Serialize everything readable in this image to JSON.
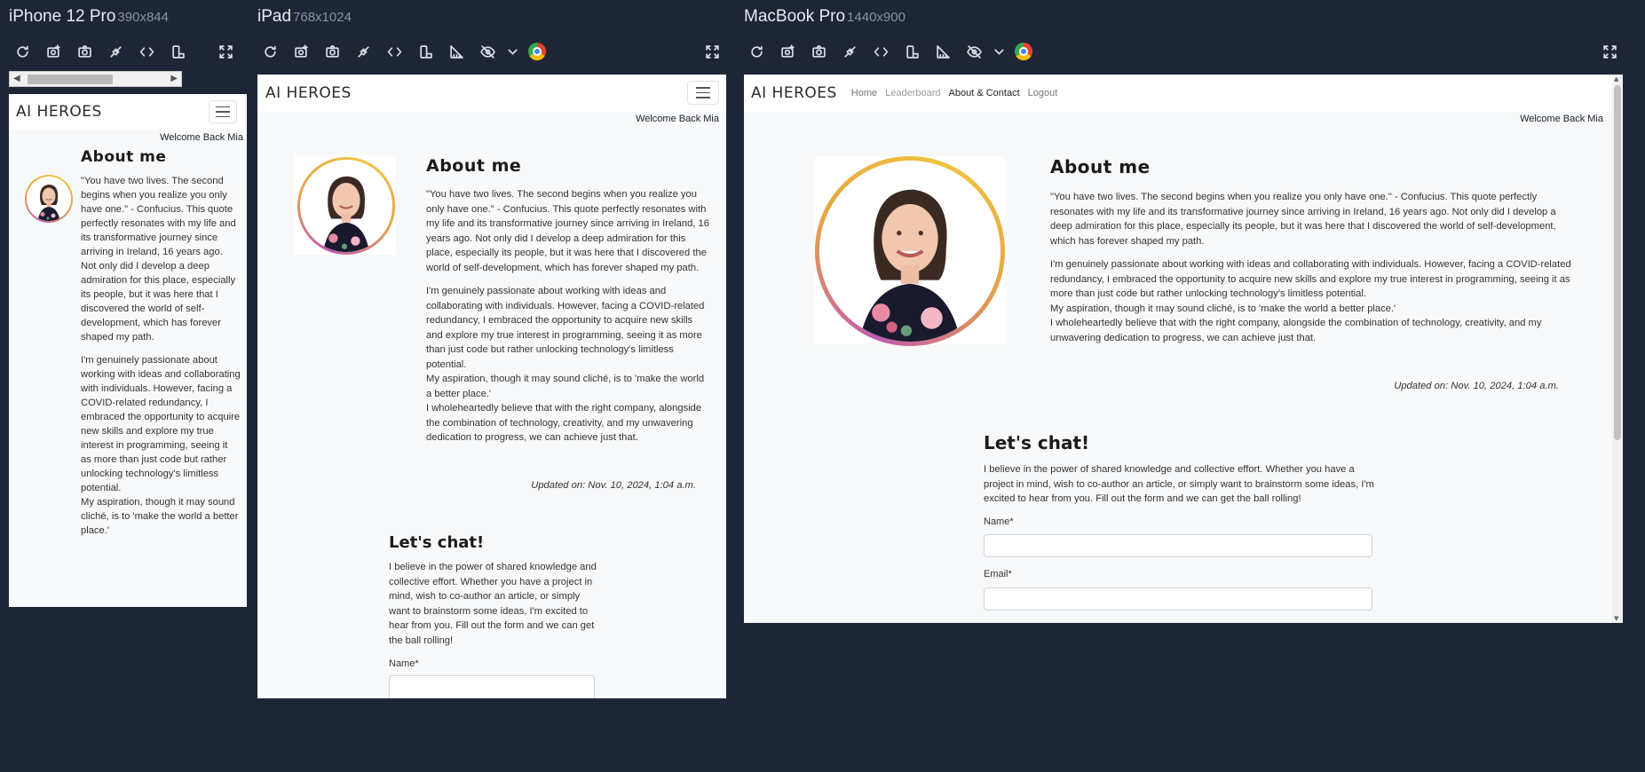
{
  "devices": [
    {
      "name": "iPhone 12 Pro",
      "dims": "390x844"
    },
    {
      "name": "iPad",
      "dims": "768x1024"
    },
    {
      "name": "MacBook Pro",
      "dims": "1440x900"
    }
  ],
  "toolbar": {
    "icons": [
      "refresh-icon",
      "screenshot-icon",
      "camera-icon",
      "sync-icon",
      "code-icon",
      "rotate-icon",
      "ruler-icon",
      "eye-off-icon",
      "chevron-down-icon",
      "chrome-icon",
      "fullscreen-icon"
    ]
  },
  "site": {
    "brand": "AI HEROES",
    "nav": [
      "Home",
      "Leaderboard",
      "About & Contact",
      "Logout"
    ],
    "welcome": "Welcome Back Mia",
    "about_title": "About me",
    "p1": "\"You have two lives. The second begins when you realize you only have one.\" - Confucius. This quote perfectly resonates with my life and its transformative journey since arriving in Ireland, 16 years ago. Not only did I develop a deep admiration for this place, especially its people, but it was here that I discovered the world of self-development, which has forever shaped my path.",
    "p2": "I'm genuinely passionate about working with ideas and collaborating with individuals. However, facing a COVID-related redundancy, I embraced the opportunity to acquire new skills and explore my true interest in programming, seeing it as more than just code but rather unlocking technology's limitless potential.",
    "p3": "My aspiration, though it may sound cliché, is to 'make the world a better place.'",
    "p4": "I wholeheartedly believe that with the right company, alongside the combination of technology, creativity, and my unwavering dedication to progress, we can achieve just that.",
    "updated": "Updated on: Nov. 10, 2024, 1:04 a.m.",
    "chat_title": "Let's chat!",
    "chat_text": "I believe in the power of shared knowledge and collective effort. Whether you have a project in mind, wish to co-author an article, or simply want to brainstorm some ideas, I'm excited to hear from you. Fill out the form and we can get the ball rolling!",
    "name_label": "Name*",
    "email_label": "Email*"
  },
  "colors": {
    "background": "#1e2636",
    "page": "#f8f9fa",
    "avatar_ring_start": "#f0c440",
    "avatar_ring_end": "#c15ab0"
  }
}
